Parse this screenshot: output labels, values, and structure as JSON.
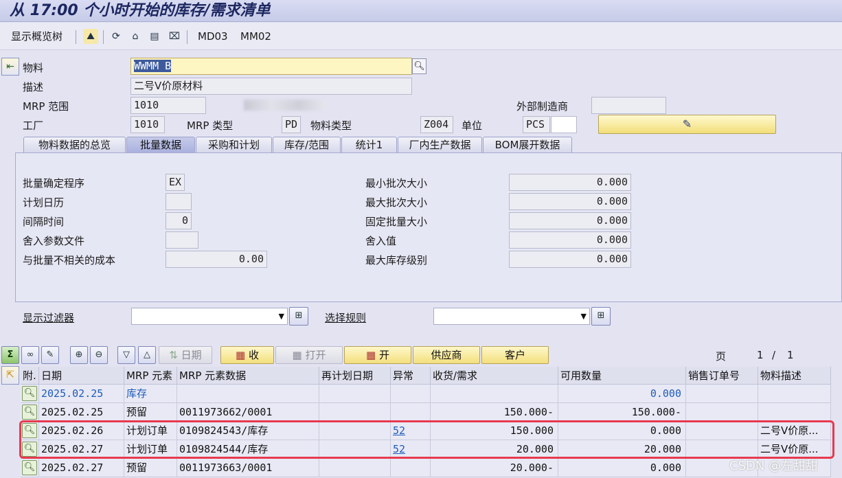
{
  "window": {
    "title": "从 17:00 个小时开始的库存/需求清单"
  },
  "toolbar": {
    "overview_tree": "显示概览树",
    "md03": "MD03",
    "mm02": "MM02"
  },
  "header": {
    "material_label": "物料",
    "material_value": "WWMM B",
    "description_label": "描述",
    "description_value": "二号V价原材料",
    "mrp_area_label": "MRP 范围",
    "mrp_area_value": "1010",
    "external_mfr_label": "外部制造商",
    "plant_label": "工厂",
    "plant_value": "1010",
    "mrp_type_label": "MRP 类型",
    "mrp_type_value": "PD",
    "material_type_label": "物料类型",
    "material_type_value": "Z004",
    "unit_label": "单位",
    "unit_value": "PCS"
  },
  "tabs": [
    {
      "label": "物料数据的总览"
    },
    {
      "label": "批量数据"
    },
    {
      "label": "采购和计划"
    },
    {
      "label": "库存/范围"
    },
    {
      "label": "统计1"
    },
    {
      "label": "厂内生产数据"
    },
    {
      "label": "BOM展开数据"
    }
  ],
  "lot_data": {
    "lot_procedure_label": "批量确定程序",
    "lot_procedure_value": "EX",
    "planning_calendar_label": "计划日历",
    "planning_calendar_value": "",
    "interval_label": "间隔时间",
    "interval_value": "0",
    "rounding_profile_label": "舍入参数文件",
    "rounding_profile_value": "",
    "lot_independent_cost_label": "与批量不相关的成本",
    "lot_independent_cost_value": "0.00",
    "min_lot_label": "最小批次大小",
    "min_lot_value": "0.000",
    "max_lot_label": "最大批次大小",
    "max_lot_value": "0.000",
    "fixed_lot_label": "固定批量大小",
    "fixed_lot_value": "0.000",
    "rounding_value_label": "舍入值",
    "rounding_value_value": "0.000",
    "max_stock_label": "最大库存级别",
    "max_stock_value": "0.000"
  },
  "filters": {
    "display_filter_label": "显示过滤器",
    "selection_rule_label": "选择规则"
  },
  "grid_toolbar": {
    "date_label": "日期",
    "receipt_label": "收",
    "open_label": "打开",
    "open2_label": "开",
    "vendor_label": "供应商",
    "customer_label": "客户",
    "page_label": "页",
    "page_current": "1",
    "page_sep": "/",
    "page_total": "1"
  },
  "grid": {
    "columns": [
      "附.",
      "日期",
      "MRP 元素",
      "MRP 元素数据",
      "再计划日期",
      "异常",
      "收货/需求",
      "可用数量",
      "销售订单号",
      "物料描述"
    ],
    "rows": [
      {
        "date": "2025.02.25",
        "element": "库存",
        "data": "",
        "replan": "",
        "exception": "",
        "qty": "",
        "available": "0.000",
        "so": "",
        "desc": ""
      },
      {
        "date": "2025.02.25",
        "element": "预留",
        "data": "0011973662/0001",
        "replan": "",
        "exception": "",
        "qty": "150.000-",
        "available": "150.000-",
        "so": "",
        "desc": ""
      },
      {
        "date": "2025.02.26",
        "element": "计划订单",
        "data": "0109824543/库存",
        "replan": "",
        "exception": "52",
        "qty": "150.000",
        "available": "0.000",
        "so": "",
        "desc": "二号V价原..."
      },
      {
        "date": "2025.02.27",
        "element": "计划订单",
        "data": "0109824544/库存",
        "replan": "",
        "exception": "52",
        "qty": "20.000",
        "available": "20.000",
        "so": "",
        "desc": "二号V价原..."
      },
      {
        "date": "2025.02.27",
        "element": "预留",
        "data": "0011973663/0001",
        "replan": "",
        "exception": "",
        "qty": "20.000-",
        "available": "0.000",
        "so": "",
        "desc": ""
      }
    ]
  },
  "watermark": "CSDN @左甜甜"
}
